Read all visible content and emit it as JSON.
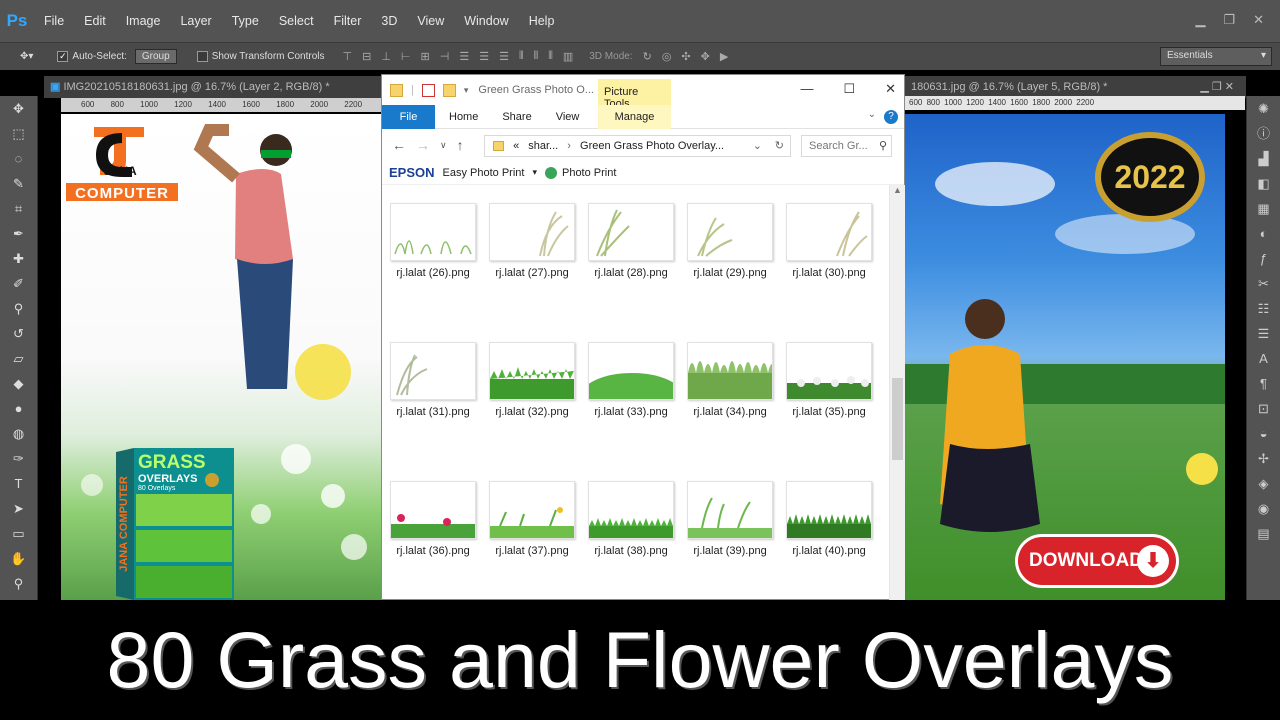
{
  "photoshop": {
    "logo": "Ps",
    "menu": [
      "File",
      "Edit",
      "Image",
      "Layer",
      "Type",
      "Select",
      "Filter",
      "3D",
      "View",
      "Window",
      "Help"
    ],
    "options": {
      "auto_select": "Auto-Select:",
      "group": "Group",
      "transform": "Show Transform Controls",
      "mode_3d": "3D Mode:",
      "workspace": "Essentials"
    },
    "doc_left_title": "IMG20210518180631.jpg @ 16.7% (Layer 2, RGB/8) *",
    "doc_right_title": "180631.jpg @ 16.7% (Layer 5, RGB/8) *",
    "ruler_marks": "600  800  1000  1200  1400  1600  1800  2000  2200"
  },
  "left_canvas": {
    "logo_top": "JANA",
    "logo_word": "COMPUTER",
    "product_title": "GRASS",
    "product_sub": "OVERLAYS",
    "product_note": "80 Overlays",
    "product_side": "JANA COMPUTER"
  },
  "right_canvas": {
    "badge_year": "2022",
    "download_label": "DOWNLOAD"
  },
  "explorer": {
    "title": "Green Grass Photo O...",
    "picture_tools": "Picture Tools",
    "tabs": [
      "File",
      "Home",
      "Share",
      "View"
    ],
    "manage": "Manage",
    "address_prefix": "«",
    "address_parts": [
      "shar...",
      "Green Grass Photo Overlay..."
    ],
    "search_placeholder": "Search Gr...",
    "epson_brand": "EPSON",
    "easy_print": "Easy Photo Print",
    "photo_print": "Photo Print",
    "files": [
      {
        "name": "rj.lalat (26).png"
      },
      {
        "name": "rj.lalat (27).png"
      },
      {
        "name": "rj.lalat (28).png"
      },
      {
        "name": "rj.lalat (29).png"
      },
      {
        "name": "rj.lalat (30).png"
      },
      {
        "name": "rj.lalat (31).png"
      },
      {
        "name": "rj.lalat (32).png"
      },
      {
        "name": "rj.lalat (33).png"
      },
      {
        "name": "rj.lalat (34).png"
      },
      {
        "name": "rj.lalat (35).png"
      },
      {
        "name": "rj.lalat (36).png"
      },
      {
        "name": "rj.lalat (37).png"
      },
      {
        "name": "rj.lalat (38).png"
      },
      {
        "name": "rj.lalat (39).png"
      },
      {
        "name": "rj.lalat (40).png"
      }
    ]
  },
  "banner": {
    "text": "80 Grass and Flower Overlays"
  }
}
